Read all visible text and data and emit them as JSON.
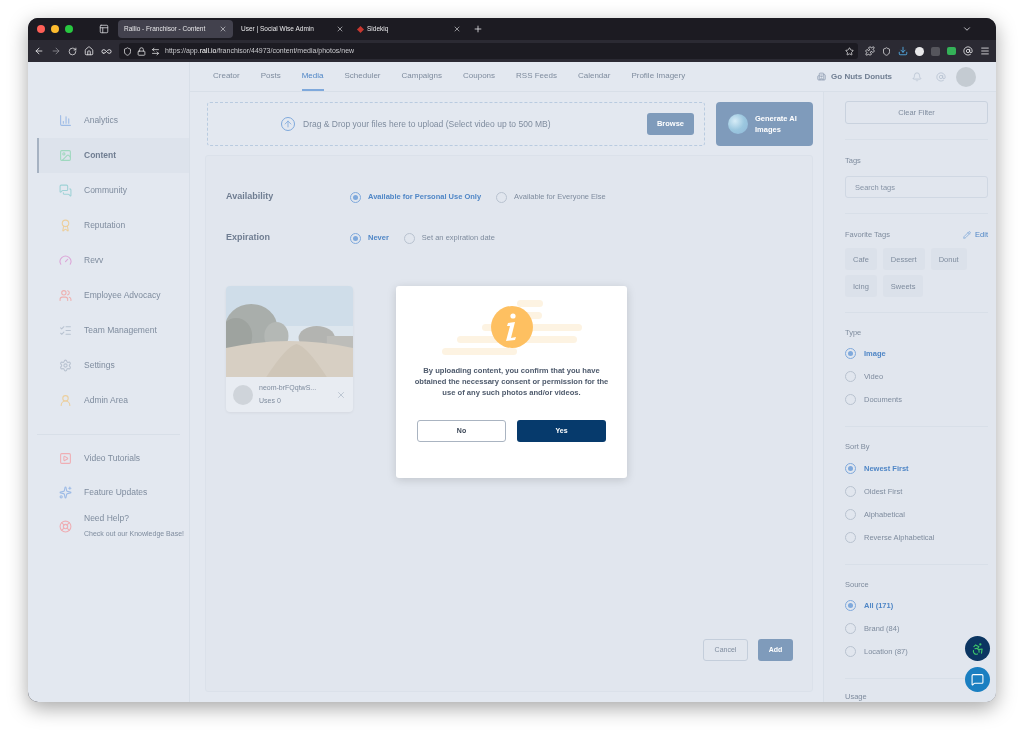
{
  "browser": {
    "tabs": [
      {
        "title": "Rallio - Franchisor - Content",
        "selected": true
      },
      {
        "title": "User | Social Wise Admin",
        "selected": false
      },
      {
        "title": "Sidekiq",
        "selected": false
      }
    ],
    "url_prefix": "https://app.",
    "url_domain": "rall.io",
    "url_path": "/franchisor/44973/content/media/photos/new"
  },
  "sidebar": {
    "items": [
      {
        "label": "Analytics",
        "selected": false
      },
      {
        "label": "Content",
        "selected": true
      },
      {
        "label": "Community",
        "selected": false
      },
      {
        "label": "Reputation",
        "selected": false
      },
      {
        "label": "Revv",
        "selected": false
      },
      {
        "label": "Employee Advocacy",
        "selected": false
      },
      {
        "label": "Team Management",
        "selected": false
      },
      {
        "label": "Settings",
        "selected": false
      },
      {
        "label": "Admin Area",
        "selected": false
      }
    ],
    "help_items": [
      {
        "label": "Video Tutorials"
      },
      {
        "label": "Feature Updates"
      },
      {
        "label": "Need Help?",
        "sublabel": "Check out our Knowledge Base!"
      }
    ]
  },
  "nav": {
    "tabs": [
      {
        "label": "Creator",
        "selected": false
      },
      {
        "label": "Posts",
        "selected": false
      },
      {
        "label": "Media",
        "selected": true
      },
      {
        "label": "Scheduler",
        "selected": false
      },
      {
        "label": "Campaigns",
        "selected": false
      },
      {
        "label": "Coupons",
        "selected": false
      },
      {
        "label": "RSS Feeds",
        "selected": false
      },
      {
        "label": "Calendar",
        "selected": false
      },
      {
        "label": "Profile Imagery",
        "selected": false
      }
    ],
    "account": "Go Nuts Donuts"
  },
  "upload": {
    "prompt": "Drag & Drop your files here to upload (Select video up to 500 MB)",
    "browse": "Browse",
    "generate": "Generate AI Images"
  },
  "form": [
    {
      "label": "Availability",
      "options": [
        {
          "label": "Available for Personal Use Only",
          "selected": true
        },
        {
          "label": "Available for Everyone Else",
          "selected": false
        }
      ]
    },
    {
      "label": "Expiration",
      "options": [
        {
          "label": "Never",
          "selected": true
        },
        {
          "label": "Set an expiration date",
          "selected": false
        }
      ]
    }
  ],
  "media": [
    {
      "kind": "picture",
      "filename": "neom-brFQqtwS...",
      "uses_label": "Uses",
      "uses": "0"
    }
  ],
  "actions": {
    "cancel": "Cancel",
    "add": "Add"
  },
  "filters": {
    "clear": "Clear Filter",
    "tags_title": "Tags",
    "tags_placeholder": "Search tags",
    "favorite_title": "Favorite Tags",
    "edit": "Edit",
    "favorite_tags": [
      "Cafe",
      "Dessert",
      "Donut",
      "Icing",
      "Sweets"
    ],
    "groups": [
      {
        "title": "Type",
        "options": [
          {
            "label": "Image",
            "selected": true
          },
          {
            "label": "Video",
            "selected": false
          },
          {
            "label": "Documents",
            "selected": false
          }
        ]
      },
      {
        "title": "Sort By",
        "options": [
          {
            "label": "Newest First",
            "selected": true
          },
          {
            "label": "Oldest First",
            "selected": false
          },
          {
            "label": "Alphabetical",
            "selected": false
          },
          {
            "label": "Reverse Alphabetical",
            "selected": false
          }
        ]
      },
      {
        "title": "Source",
        "options": [
          {
            "label": "All (171)",
            "selected": true
          },
          {
            "label": "Brand (84)",
            "selected": false
          },
          {
            "label": "Location (87)",
            "selected": false
          }
        ]
      }
    ],
    "usage_title": "Usage"
  },
  "dialog": {
    "message": "By uploading content, you confirm that you have obtained the necessary consent or permission for the use of any such photos and/or videos.",
    "no": "No",
    "yes": "Yes"
  }
}
